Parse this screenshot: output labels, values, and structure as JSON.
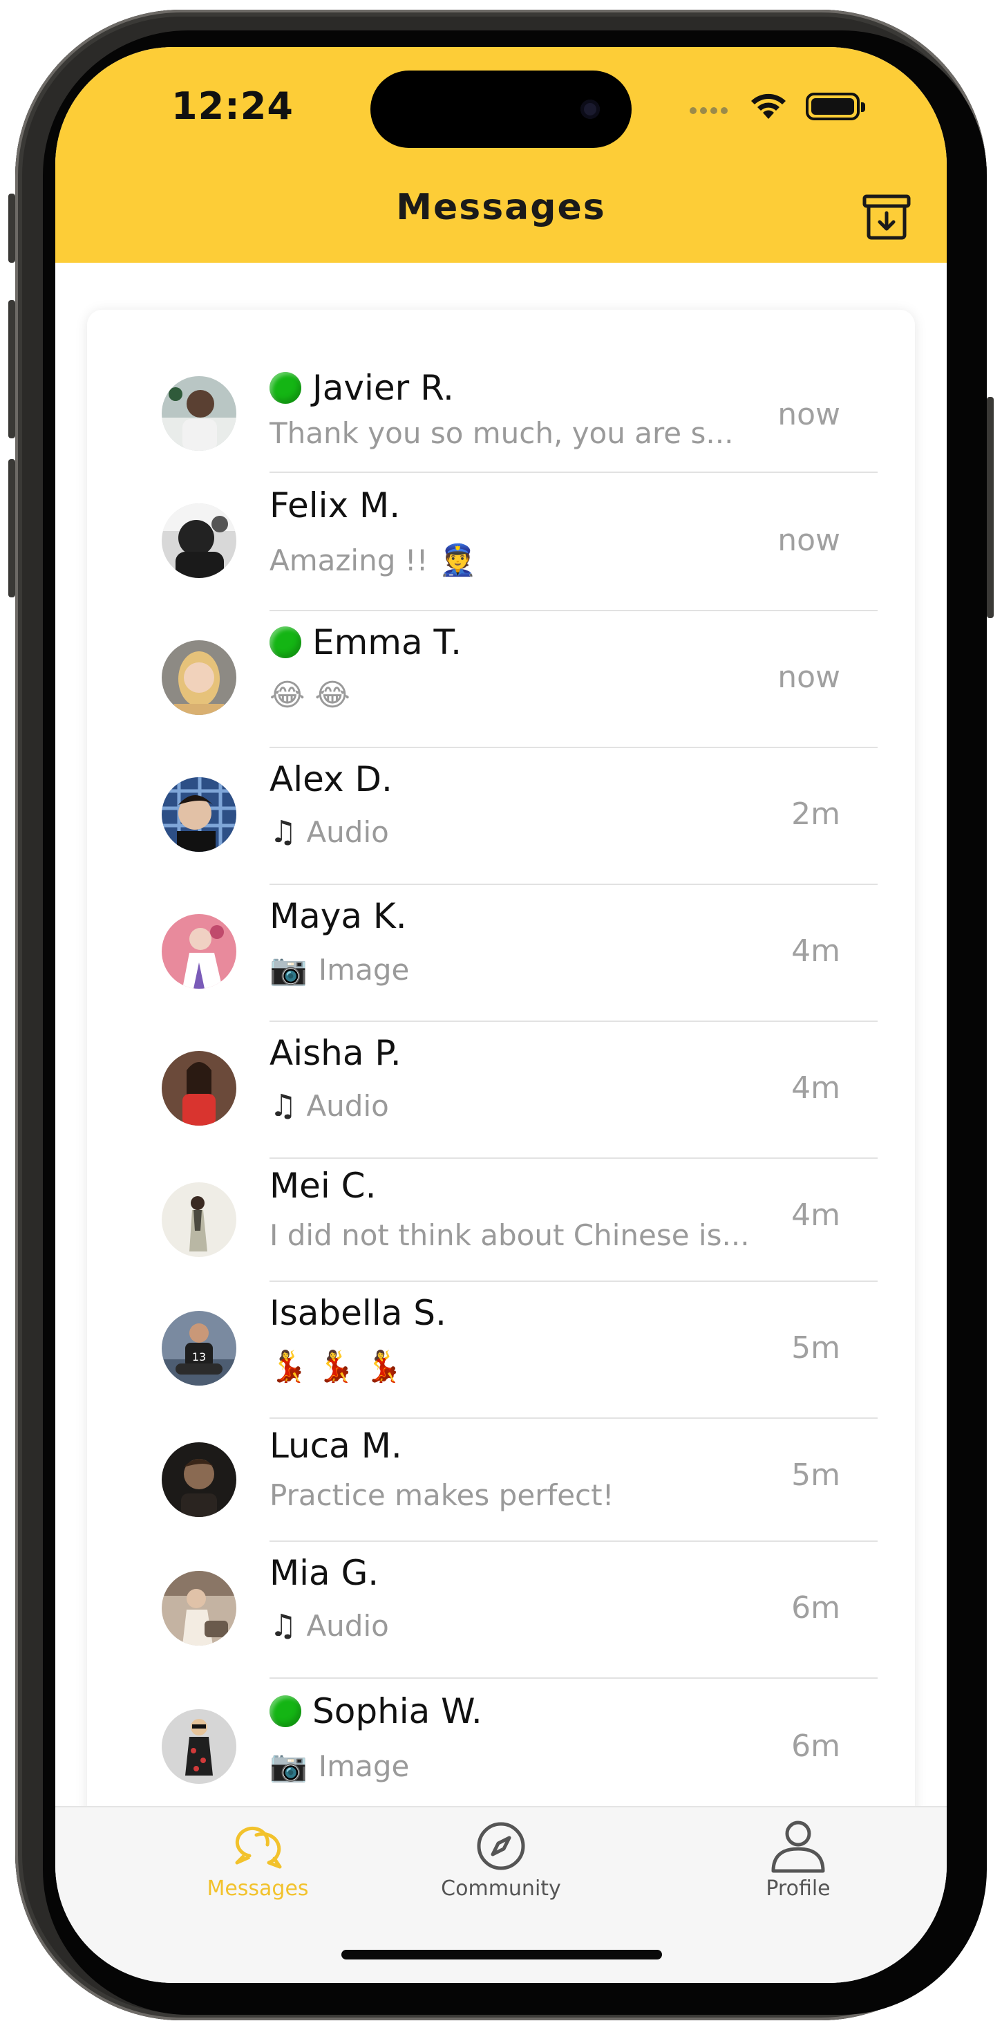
{
  "status_bar": {
    "time": "12:24"
  },
  "header": {
    "title": "Messages",
    "archive_icon": "archive-download-icon",
    "background": "#fdcd37"
  },
  "conversations": [
    {
      "name": "Javier R.",
      "online": true,
      "preview": "Thank you so much, you are s...",
      "preview_icon": "",
      "time": "now"
    },
    {
      "name": "Felix M.",
      "online": false,
      "preview": "Amazing !!",
      "preview_icon": "👮",
      "time": "now"
    },
    {
      "name": "Emma T.",
      "online": true,
      "preview": "😂 😂",
      "preview_icon": "",
      "time": "now"
    },
    {
      "name": "Alex D.",
      "online": false,
      "preview": "Audio",
      "preview_icon": "♫",
      "time": "2m"
    },
    {
      "name": "Maya K.",
      "online": false,
      "preview": "Image",
      "preview_icon": "📷",
      "time": "4m"
    },
    {
      "name": "Aisha P.",
      "online": false,
      "preview": "Audio",
      "preview_icon": "♫",
      "time": "4m"
    },
    {
      "name": "Mei C.",
      "online": false,
      "preview": "I did not think about Chinese is...",
      "preview_icon": "",
      "time": "4m"
    },
    {
      "name": "Isabella S.",
      "online": false,
      "preview": "💃 💃 💃",
      "preview_icon": "",
      "time": "5m"
    },
    {
      "name": "Luca M.",
      "online": false,
      "preview": "Practice makes perfect!",
      "preview_icon": "",
      "time": "5m"
    },
    {
      "name": "Mia G.",
      "online": false,
      "preview": "Audio",
      "preview_icon": "♫",
      "time": "6m"
    },
    {
      "name": "Sophia W.",
      "online": true,
      "preview": "Image",
      "preview_icon": "📷",
      "time": "6m"
    }
  ],
  "tabbar": {
    "tabs": [
      {
        "label": "Messages",
        "icon": "chat-bubbles-icon",
        "active": true
      },
      {
        "label": "Community",
        "icon": "compass-icon",
        "active": false
      },
      {
        "label": "Profile",
        "icon": "person-icon",
        "active": false
      }
    ],
    "active_color": "#f2c22c",
    "inactive_color": "#555555"
  }
}
